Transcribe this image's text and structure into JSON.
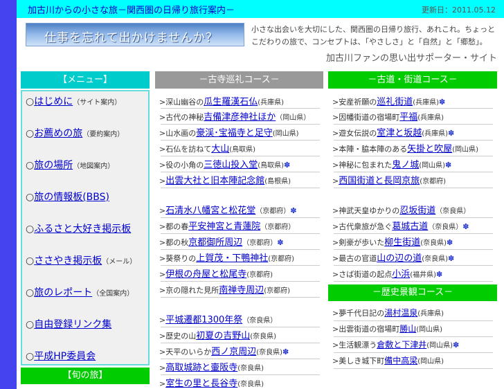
{
  "header": {
    "title": "加古川からの小さな旅－関西圏の日帰り旅行案内－",
    "updated": "更新日：2011.05.12"
  },
  "banner": {
    "text": "仕事を忘れて出かけませんか？"
  },
  "intro": {
    "line1": "小さな出会いを大切にした、関西圏の日帰り旅行、あれこれ。ちょっと",
    "line2": "こだわりの旅で、コンセプトは、「やさしさ」と「自然」と「郷愁」。",
    "tagline": "加古川ファンの思い出サポーター・サイト"
  },
  "menu": {
    "heading": "【メニュー】",
    "items": [
      {
        "label": "はじめに",
        "sub": "（サイト案内）"
      },
      {
        "label": "お薦めの旅",
        "sub": "（要約案内）"
      },
      {
        "label": "旅の場所",
        "sub": "（地図案内）"
      },
      {
        "label": "旅の情報板(BBS)",
        "sub": ""
      },
      {
        "label": "ふるさと大好き掲示板",
        "sub": ""
      },
      {
        "label": "ささやき掲示板",
        "sub": "（メール）"
      },
      {
        "label": "旅のレポート",
        "sub": "（全国案内）"
      },
      {
        "label": "自由登録リンク集",
        "sub": ""
      },
      {
        "label": "平成HP委員会",
        "sub": ""
      }
    ],
    "circle": "○",
    "season_heading": "【旬の旅】"
  },
  "temples": {
    "heading": "－古寺巡礼コース－",
    "items": [
      {
        "pre": "深山幽谷の",
        "link": "瓜生羅漢石仏",
        "suf": "(兵庫県)",
        "star": false,
        "size": "big"
      },
      {
        "pre": "古代の神秘",
        "link": "吉備津彦神社ほか",
        "suf": "（岡山県）",
        "star": false,
        "size": "big"
      },
      {
        "pre": "山水画の",
        "link": "豪渓･宝福寺と足守",
        "suf": "(岡山県)",
        "star": false,
        "size": "big"
      },
      {
        "pre": "石仏を訪ねて",
        "link": "大山",
        "suf": "(鳥取県)",
        "star": false,
        "size": "big"
      },
      {
        "pre": "役の小角の",
        "link": "三徳山投入堂",
        "suf": "(鳥取県)",
        "star": true,
        "size": "big"
      },
      {
        "pre": "",
        "link": "出雲大社と旧本陣記念館",
        "suf": "(島根県)",
        "star": false,
        "size": "big"
      },
      {
        "pre": "",
        "link": "石清水八幡宮と松花堂",
        "suf": "（京都府）",
        "star": true,
        "size": "big"
      },
      {
        "pre": "都の春",
        "link": "平安神宮と青蓮院",
        "suf": "（京都府）",
        "star": false,
        "size": "big"
      },
      {
        "pre": "都の秋",
        "link": "京都御所周辺",
        "suf": "（京都府）",
        "star": true,
        "size": "big"
      },
      {
        "pre": "葵祭りの",
        "link": "上賀茂・下鴨神社",
        "suf": "(京都府)",
        "star": false,
        "size": "big"
      },
      {
        "pre": "",
        "link": "伊根の舟屋と松尾寺",
        "suf": "(京都府)",
        "star": false,
        "size": "big"
      },
      {
        "pre": "京の隠れた見所",
        "link": "南禅寺周辺",
        "suf": "(京都府)",
        "star": false,
        "size": "big"
      },
      {
        "pre": "",
        "link": "平城遷都1300年祭",
        "suf": "（奈良県）",
        "star": false,
        "size": "big"
      },
      {
        "pre": "歴史の山",
        "link": "初夏の吉野山",
        "suf": "(奈良県)",
        "star": false,
        "size": "big"
      },
      {
        "pre": "天平のいらか",
        "link": "西ノ京周辺",
        "suf": "(奈良県)",
        "star": true,
        "size": "big"
      },
      {
        "pre": "",
        "link": "高取城跡と壷阪寺",
        "suf": "(奈良県)",
        "star": false,
        "size": "big"
      },
      {
        "pre": "",
        "link": "室生の里と長谷寺",
        "suf": "(奈良県)",
        "star": false,
        "size": "big"
      }
    ]
  },
  "roads": {
    "heading": "－古道・街道コース－",
    "items": [
      {
        "pre": "安産祈願の",
        "link": "巡礼街道",
        "suf": "(兵庫県)",
        "star": true,
        "size": "big"
      },
      {
        "pre": "因幡街道の宿場町",
        "link": "平福",
        "suf": "(兵庫県)",
        "star": false,
        "size": "big"
      },
      {
        "pre": "遊女伝説の",
        "link": "室津と坂越",
        "suf": "(兵庫県)",
        "star": true,
        "size": "big"
      },
      {
        "pre": "本陣・脇本陣のある",
        "link": "矢掛と吹屋",
        "suf": "(岡山県)",
        "star": false,
        "size": "big"
      },
      {
        "pre": "神秘に包まれた",
        "link": "鬼ノ城",
        "suf": "(岡山県)",
        "star": true,
        "size": "big"
      },
      {
        "pre": "",
        "link": "西国街道と長岡京旅",
        "suf": "(京都府)",
        "star": false,
        "size": "big"
      },
      {
        "pre": "神武天皇ゆかりの",
        "link": "忍坂街道",
        "suf": "（奈良県）",
        "star": false,
        "size": "big"
      },
      {
        "pre": "古代衆旅が急ぐ",
        "link": "葛城古道",
        "suf": "（奈良県）",
        "star": true,
        "size": "big"
      },
      {
        "pre": "剣豪が歩いた",
        "link": "柳生街道",
        "suf": "(奈良県)",
        "star": true,
        "size": "big"
      },
      {
        "pre": "最古の官道",
        "link": "山の辺の道",
        "suf": "(奈良県)",
        "star": true,
        "size": "big"
      },
      {
        "pre": "さば街道の起点",
        "link": "小浜",
        "suf": "(福井県)",
        "star": true,
        "size": "big"
      }
    ]
  },
  "scenery": {
    "heading": "－歴史景観コース－",
    "items": [
      {
        "pre": "夢千代日記の",
        "link": "湯村温泉",
        "suf": "(兵庫県)",
        "star": false,
        "size": "sm"
      },
      {
        "pre": "出雲街道の宿場町",
        "link": "勝山",
        "suf": "(岡山県)",
        "star": false,
        "size": "sm"
      },
      {
        "pre": "生活観漂う",
        "link": "倉敷と下津井",
        "suf": "(岡山県)",
        "star": true,
        "size": "sm"
      },
      {
        "pre": "美しき城下町",
        "link": "備中高梁",
        "suf": "(岡山県)",
        "star": false,
        "size": "sm"
      }
    ]
  },
  "bullet": ">",
  "star_glyph": "✽",
  "colors": {
    "left_bar": "#4444ee",
    "header_bg": "#00ffff",
    "link": "#0000cc",
    "menu_head": "#00cccc",
    "green_head": "#00cc00",
    "gray_head": "#999999"
  }
}
